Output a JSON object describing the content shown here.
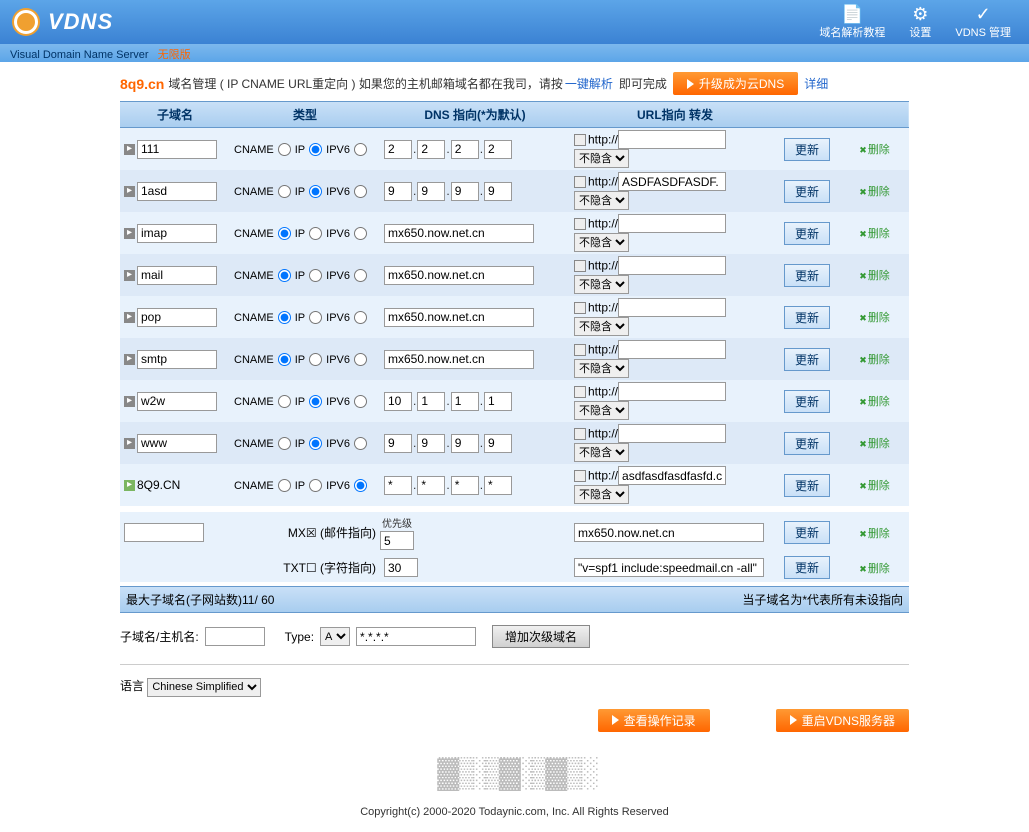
{
  "header": {
    "logo": "VDNS",
    "sub": "Visual Domain Name Server",
    "unlimited": "无限版",
    "nav": [
      {
        "label": "域名解析教程"
      },
      {
        "label": "设置"
      },
      {
        "label": "VDNS 管理"
      }
    ]
  },
  "domain": {
    "name": "8q9.cn",
    "desc1": "域名管理 ( IP CNAME URL重定向 ) 如果您的主机邮箱域名都在我司，请按",
    "link": "一键解析",
    "desc2": "即可完成",
    "upgrade": "升级成为云DNS",
    "detail": "详细"
  },
  "cols": {
    "sub": "子域名",
    "type": "类型",
    "dns": "DNS 指向(*为默认)",
    "url": "URL指向 转发"
  },
  "tpl": {
    "cname": "CNAME",
    "ip": "IP",
    "ipv6": "IPV6",
    "http": "http://",
    "update": "更新",
    "del": "删除"
  },
  "hide_opts": [
    "不隐含"
  ],
  "rows": [
    {
      "sub": "111",
      "sel": "ip",
      "dns_mode": "ip",
      "ip": [
        "2",
        "2",
        "2",
        "2"
      ],
      "url": "",
      "hide": "不隐含",
      "sq": "g"
    },
    {
      "sub": "1asd",
      "sel": "ip",
      "dns_mode": "ip",
      "ip": [
        "9",
        "9",
        "9",
        "9"
      ],
      "url": "ASDFASDFASDF.",
      "hide": "不隐含",
      "sq": "g"
    },
    {
      "sub": "imap",
      "sel": "cname",
      "dns_mode": "full",
      "full": "mx650.now.net.cn",
      "url": "",
      "hide": "不隐含",
      "sq": "g"
    },
    {
      "sub": "mail",
      "sel": "cname",
      "dns_mode": "full",
      "full": "mx650.now.net.cn",
      "url": "",
      "hide": "不隐含",
      "sq": "g"
    },
    {
      "sub": "pop",
      "sel": "cname",
      "dns_mode": "full",
      "full": "mx650.now.net.cn",
      "url": "",
      "hide": "不隐含",
      "sq": "g"
    },
    {
      "sub": "smtp",
      "sel": "cname",
      "dns_mode": "full",
      "full": "mx650.now.net.cn",
      "url": "",
      "hide": "不隐含",
      "sq": "g"
    },
    {
      "sub": "w2w",
      "sel": "ip",
      "dns_mode": "ip",
      "ip": [
        "10",
        "1",
        "1",
        "1"
      ],
      "url": "",
      "hide": "不隐含",
      "sq": "g"
    },
    {
      "sub": "www",
      "sel": "ip",
      "dns_mode": "ip",
      "ip": [
        "9",
        "9",
        "9",
        "9"
      ],
      "url": "",
      "hide": "不隐含",
      "sq": "g"
    },
    {
      "sub": "8Q9.CN",
      "sel": "ipv6",
      "dns_mode": "ip",
      "ip": [
        "*",
        "*",
        "*",
        "*"
      ],
      "url": "asdfasdfasdfasfd.c",
      "hide": "不隐含",
      "sq": "gr",
      "readonly": true
    }
  ],
  "mx": {
    "label": "MX☒ (邮件指向)",
    "prio_hdr": "优先级",
    "prio": "5",
    "value": "mx650.now.net.cn",
    "update": "更新",
    "del": "删除"
  },
  "txt": {
    "label": "TXT☐ (字符指向)",
    "prio": "30",
    "value": "\"v=spf1 include:speedmail.cn -all\"",
    "update": "更新",
    "del": "删除"
  },
  "stats": {
    "left": "最大子域名(子网站数)11/ 60",
    "right": "当子域名为*代表所有未设指向"
  },
  "add": {
    "label": "子域名/主机名:",
    "type_lbl": "Type:",
    "type_val": "A",
    "ip_ph": "*.*.*.*",
    "btn": "增加次级域名"
  },
  "lang": {
    "label": "语言",
    "value": "Chinese Simplified"
  },
  "btns": {
    "log": "查看操作记录",
    "restart": "重启VDNS服务器"
  },
  "footer": "Copyright(c) 2000-2020 Todaynic.com, Inc. All Rights Reserved"
}
